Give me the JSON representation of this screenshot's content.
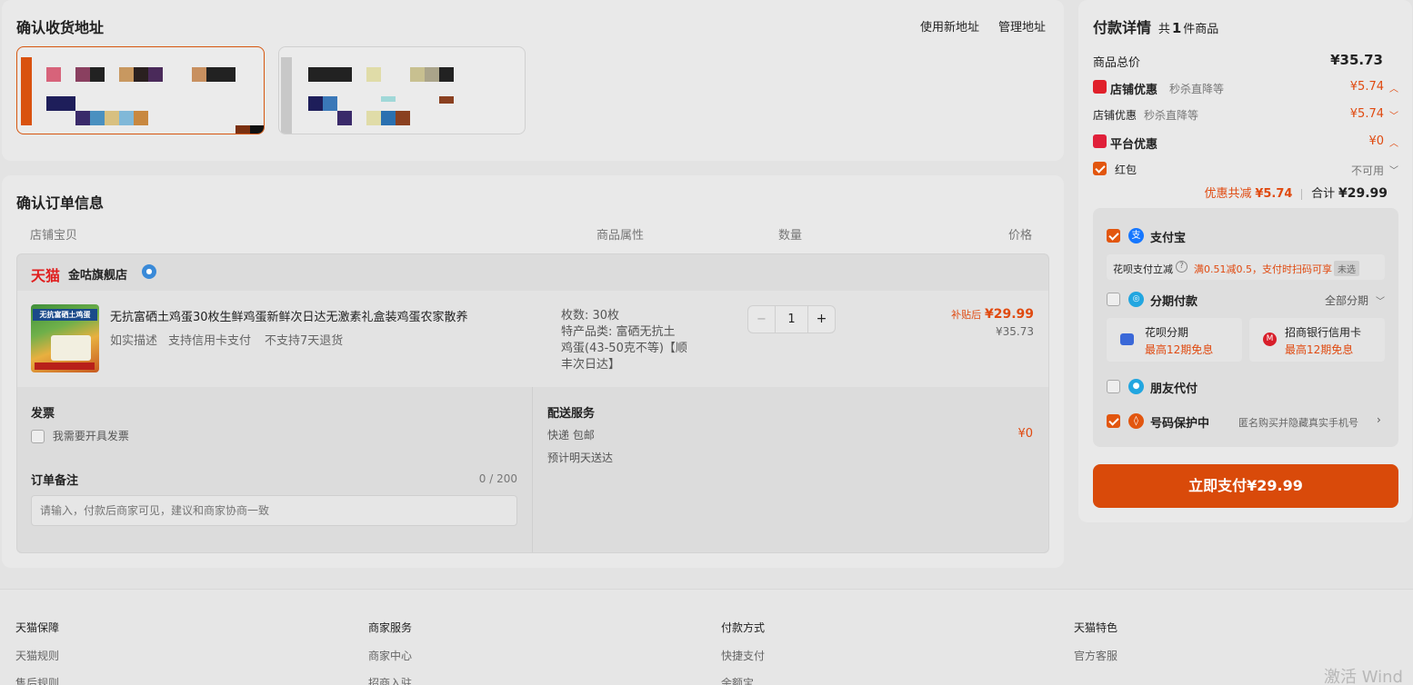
{
  "address": {
    "title": "确认收货地址",
    "new_address": "使用新地址",
    "manage_address": "管理地址"
  },
  "order": {
    "title": "确认订单信息",
    "columns": [
      "店铺宝贝",
      "商品属性",
      "数量",
      "价格"
    ],
    "shop": {
      "brand": "天猫",
      "name": "金咕旗舰店"
    },
    "item": {
      "name": "无抗富硒土鸡蛋30枚生鲜鸡蛋新鲜次日达无激素礼盒装鸡蛋农家散养",
      "tags": [
        "如实描述",
        "支持信用卡支付",
        "不支持7天退货"
      ],
      "thumb_text": "无抗富硒土鸡蛋",
      "attr_count": "枚数: 30枚",
      "attr_type_1": "特产品类: 富硒无抗土",
      "attr_type_2": "鸡蛋(43-50克不等)【顺",
      "attr_type_3": "丰次日达】",
      "qty_minus": "−",
      "qty": "1",
      "qty_plus": "+",
      "after_label": "补贴后",
      "after_price": "¥29.99",
      "orig_price": "¥35.73"
    },
    "invoice": {
      "title": "发票",
      "option": "我需要开具发票"
    },
    "remark": {
      "title": "订单备注",
      "counter": "0 / 200",
      "placeholder": "请输入，付款后商家可见，建议和商家协商一致"
    },
    "delivery": {
      "title": "配送服务",
      "method": "快递 包邮",
      "fee": "¥0",
      "eta": "预计明天送达"
    }
  },
  "payment": {
    "title": "付款详情",
    "count_prefix": "共",
    "count": "1",
    "count_suffix": "件商品",
    "total_label": "商品总价",
    "total_value": "¥35.73",
    "shop_discount_label": "店铺优惠",
    "shop_discount_sub": "秒杀直降等",
    "shop_discount_value": "¥5.74",
    "shop_discount2_label": "店铺优惠",
    "shop_discount2_sub": "秒杀直降等",
    "shop_discount2_value": "¥5.74",
    "platform_label": "平台优惠",
    "platform_value": "¥0",
    "redpacket_label": "红包",
    "redpacket_value": "不可用",
    "saved_label": "优惠共减",
    "saved_value": "¥5.74",
    "sum_label": "合计",
    "sum_value": "¥29.99",
    "methods": {
      "alipay": "支付宝",
      "huabei_promo": "花呗支付立减",
      "huabei_promo_detail": "满0.51减0.5，支付时扫码可享",
      "huabei_promo_badge": "未选",
      "installment": "分期付款",
      "installment_all": "全部分期",
      "huabei_installment": "花呗分期",
      "huabei_installment_sub": "最高12期免息",
      "cmb_installment": "招商银行信用卡",
      "cmb_installment_sub": "最高12期免息",
      "friend_pay": "朋友代付",
      "number_protect": "号码保护中",
      "number_protect_sub": "匿名购买并隐藏真实手机号"
    },
    "pay_button": "立即支付¥29.99"
  },
  "footer": {
    "cols": [
      {
        "title": "天猫保障",
        "items": [
          "天猫规则",
          "售后规则"
        ]
      },
      {
        "title": "商家服务",
        "items": [
          "商家中心",
          "招商入驻"
        ]
      },
      {
        "title": "付款方式",
        "items": [
          "快捷支付",
          "余额宝"
        ]
      },
      {
        "title": "天猫特色",
        "items": [
          "官方客服"
        ]
      }
    ],
    "watermark": "激活 Wind"
  },
  "colors": {
    "accent": "#e2560f",
    "price_red": "#e04a10",
    "background": "#e3e3e3",
    "card": "#e9e9e9"
  }
}
